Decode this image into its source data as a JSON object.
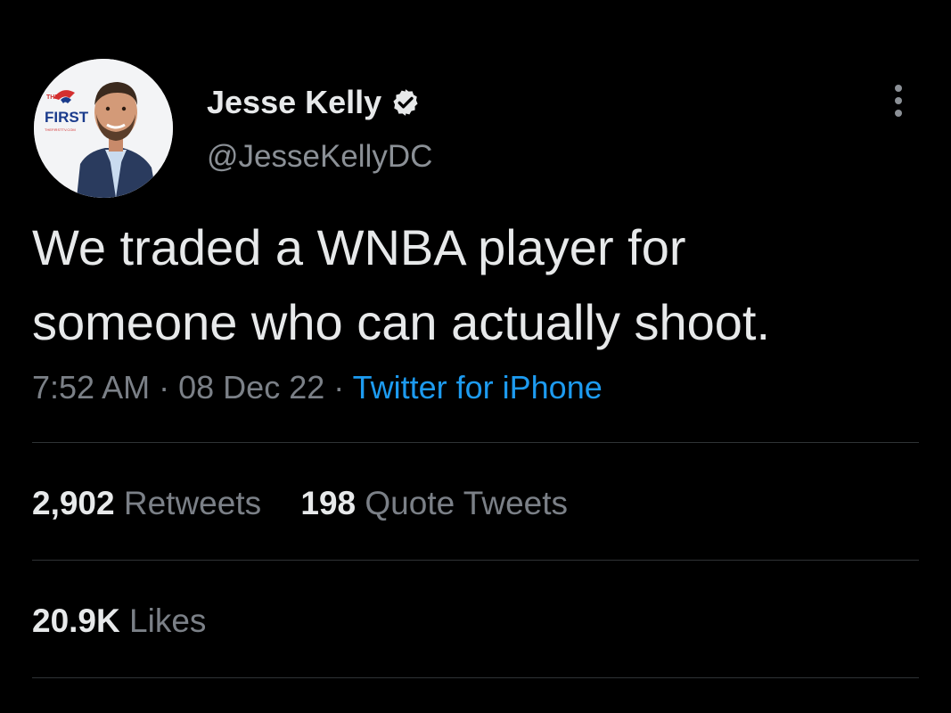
{
  "author": {
    "display_name": "Jesse Kelly",
    "handle": "@JesseKellyDC",
    "avatar_badge_small": "THE",
    "avatar_badge_large": "FIRST",
    "avatar_badge_url": "THEFIRSTTV.COM",
    "verified": true
  },
  "tweet": {
    "text_line1": "We traded a WNBA player for",
    "text_line2": "someone who can actually shoot.",
    "time": "7:52 AM",
    "separator": "·",
    "date": "08 Dec 22",
    "source": "Twitter for iPhone"
  },
  "stats": {
    "retweets_count": "2,902",
    "retweets_label": "Retweets",
    "quotes_count": "198",
    "quotes_label": "Quote Tweets",
    "likes_count": "20.9K",
    "likes_label": "Likes"
  },
  "icons": {
    "verified": "verified-badge-icon",
    "more": "more-vertical-icon"
  },
  "colors": {
    "background": "#000000",
    "primary_text": "#e7e9ea",
    "secondary_text": "#7b8087",
    "link": "#1d9bf0",
    "divider": "#2f3336",
    "badge_red": "#d32f2f",
    "badge_blue": "#1a3b8c"
  }
}
